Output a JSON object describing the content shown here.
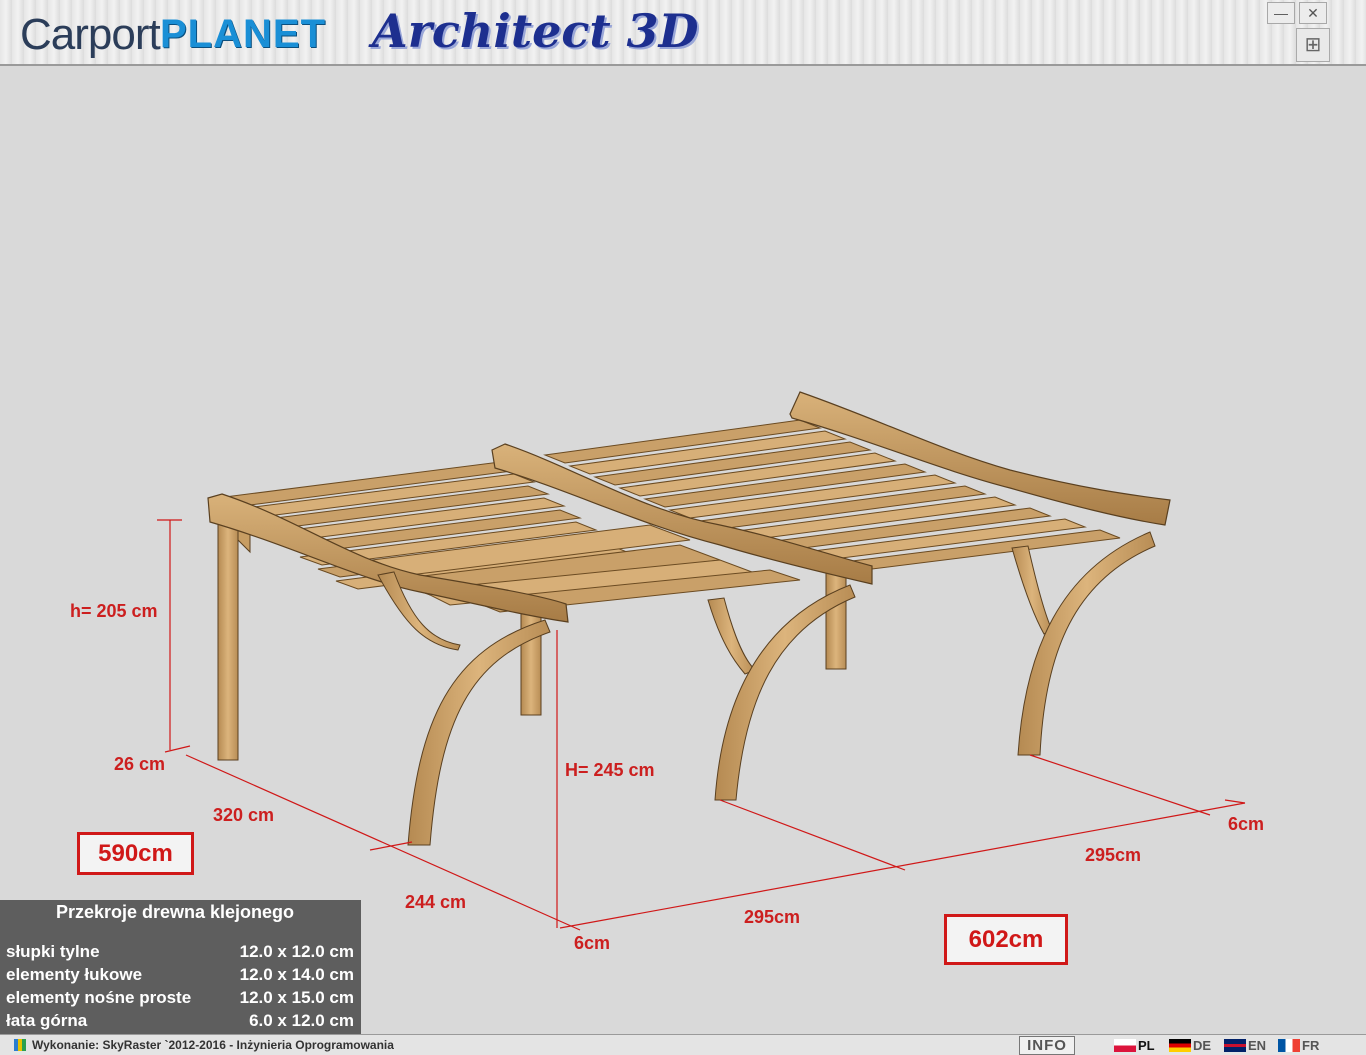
{
  "app": {
    "logo_carport": "Carport",
    "logo_planet": "PLANET",
    "logo_architect": "Architect 3D",
    "min_glyph": "—",
    "close_glyph": "✕",
    "expand_glyph": "⊞"
  },
  "dimensions": {
    "h_label": "h= 205 cm",
    "base_label": "26 cm",
    "depth_label": "320 cm",
    "depth2_label": "244 cm",
    "total_depth": "590cm",
    "H_label": "H= 245 cm",
    "offset_front": "6cm",
    "span_front": "295cm",
    "span_back": "295cm",
    "offset_back": "6cm",
    "total_width": "602cm"
  },
  "timber_panel": {
    "title": "Przekroje drewna klejonego",
    "rows": [
      {
        "name": "słupki tylne",
        "value": "12.0 x 12.0 cm"
      },
      {
        "name": "elementy łukowe",
        "value": "12.0 x 14.0 cm"
      },
      {
        "name": "elementy nośne proste",
        "value": "12.0 x 15.0 cm"
      },
      {
        "name": "łata górna",
        "value": "6.0 x 12.0 cm"
      }
    ]
  },
  "statusbar": {
    "credit": "Wykonanie: SkyRaster `2012-2016 - Inżynieria Oprogramowania",
    "info": "INFO",
    "languages": [
      "PL",
      "DE",
      "EN",
      "FR"
    ]
  }
}
